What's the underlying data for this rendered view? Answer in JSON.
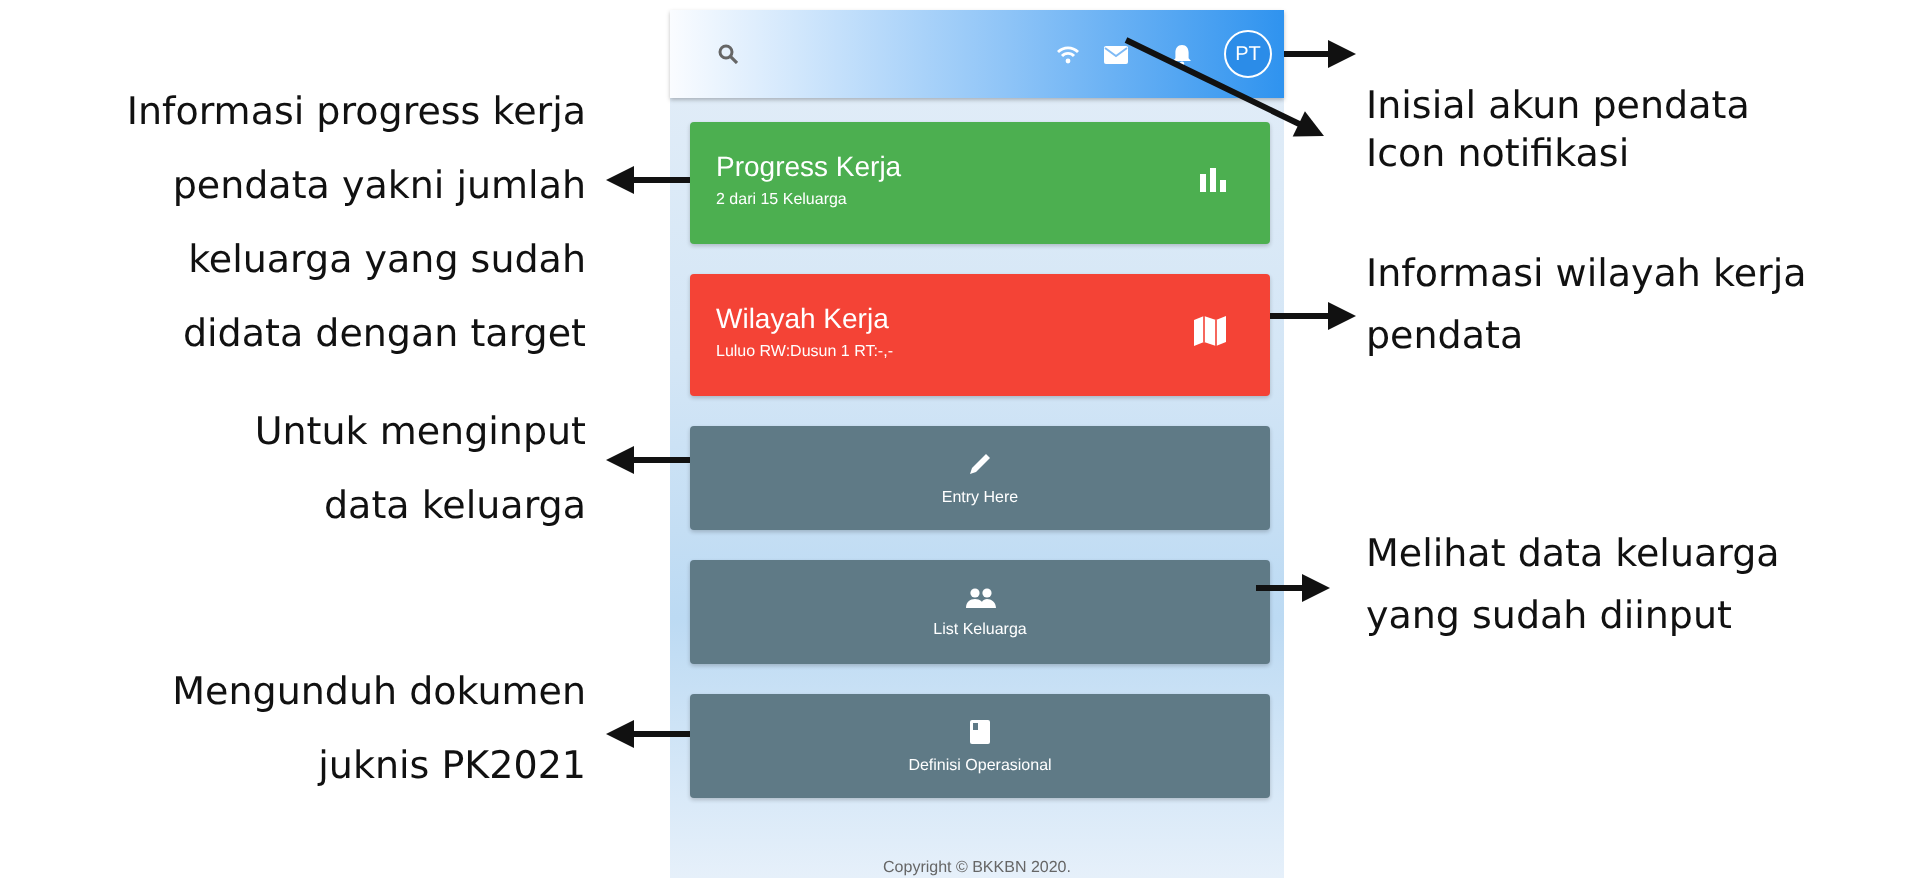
{
  "app_header": {
    "avatar_initials": "PT"
  },
  "cards": [
    {
      "kind": "stat",
      "title": "Progress Kerja",
      "subtitle": "2 dari 15 Keluarga",
      "color": "#4caf50"
    },
    {
      "kind": "stat",
      "title": "Wilayah Kerja",
      "subtitle": "Luluo RW:Dusun 1 RT:-,-",
      "color": "#f44336"
    },
    {
      "kind": "action",
      "label": "Entry Here"
    },
    {
      "kind": "action",
      "label": "List Keluarga"
    },
    {
      "kind": "action",
      "label": "Definisi Operasional"
    }
  ],
  "footer": "Copyright © BKKBN 2020.",
  "left_callouts": [
    {
      "text": "Informasi progress kerja pendata yakni jumlah keluarga yang sudah didata dengan target"
    },
    {
      "text": "Untuk menginput data keluarga"
    },
    {
      "text": "Mengunduh dokumen juknis PK2021"
    }
  ],
  "right_callouts": [
    {
      "text": "Inisial akun pendata"
    },
    {
      "text": "Icon notifikasi"
    },
    {
      "text": "Informasi wilayah kerja pendata"
    },
    {
      "text": "Melihat data keluarga yang sudah diinput"
    }
  ]
}
